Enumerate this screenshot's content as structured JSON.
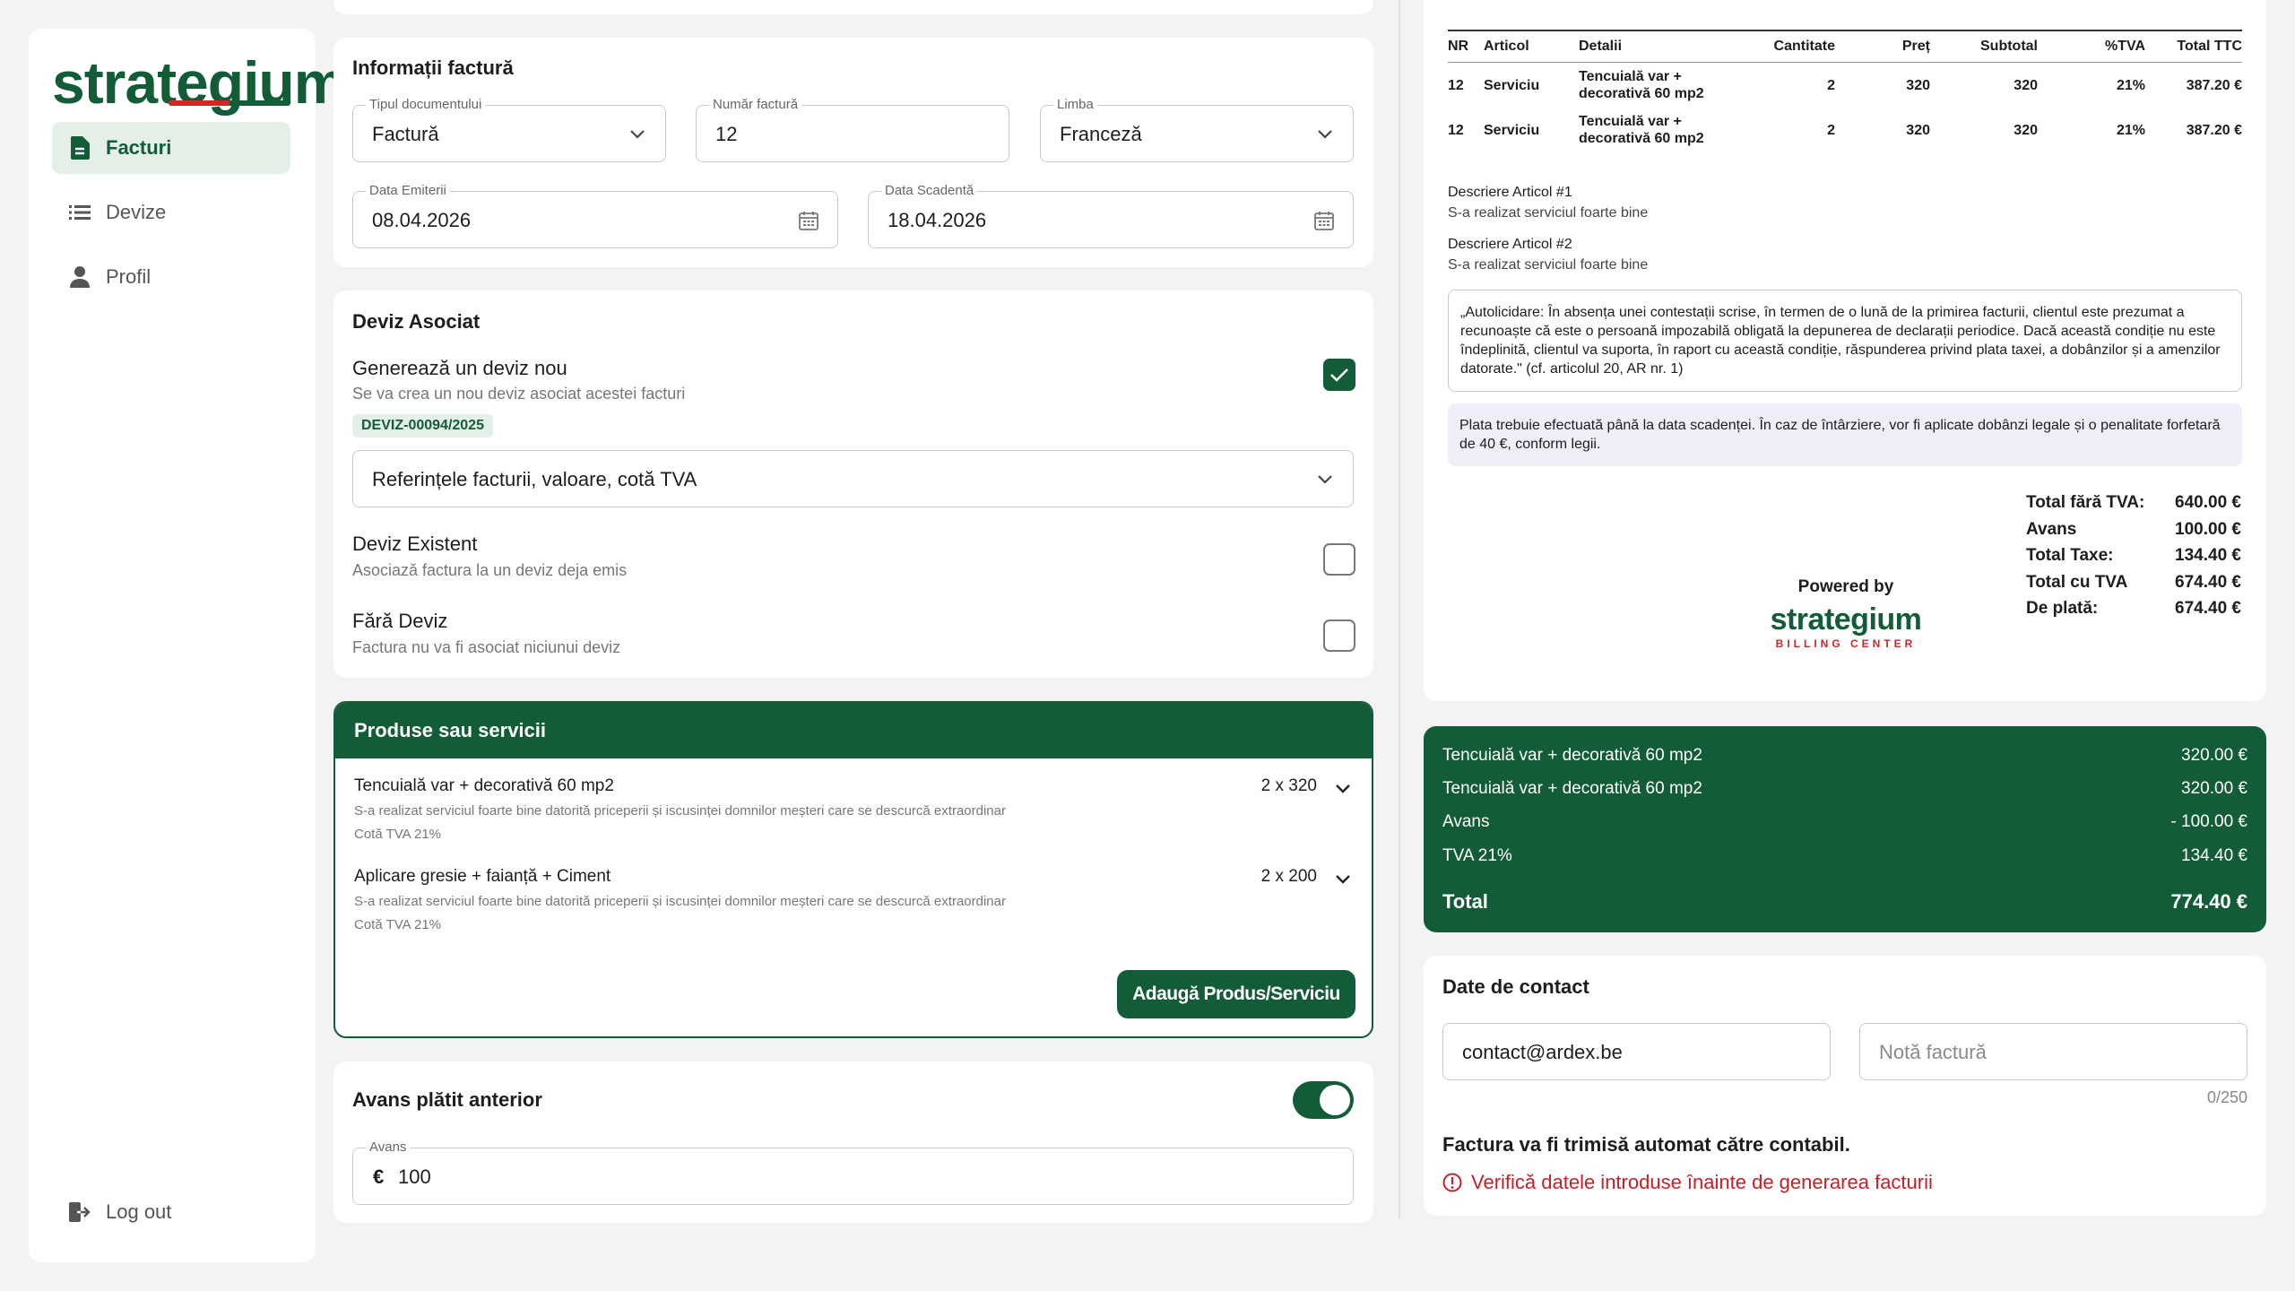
{
  "brand": {
    "logo_text": "strategium"
  },
  "sidebar": {
    "items": [
      {
        "label": "Facturi",
        "icon": "document-icon",
        "active": true
      },
      {
        "label": "Devize",
        "icon": "list-icon",
        "active": false
      },
      {
        "label": "Profil",
        "icon": "person-icon",
        "active": false
      }
    ],
    "logout_label": "Log out"
  },
  "invoice_info": {
    "title": "Informații factură",
    "doc_type": {
      "label": "Tipul documentului",
      "value": "Factură"
    },
    "number": {
      "label": "Număr factură",
      "value": "12"
    },
    "language": {
      "label": "Limba",
      "value": "Franceză"
    },
    "issue_date": {
      "label": "Data Emiterii",
      "value": "08.04.2026"
    },
    "due_date": {
      "label": "Data Scadentă",
      "value": "18.04.2026"
    }
  },
  "deviz": {
    "title": "Deviz Asociat",
    "new": {
      "title": "Generează un deviz nou",
      "subtitle": "Se va crea un nou deviz asociat acestei facturi",
      "checked": true
    },
    "badge": "DEVIZ-00094/2025",
    "select_value": "Referințele facturii, valoare, cotă TVA",
    "existing": {
      "title": "Deviz Existent",
      "subtitle": "Asociază factura la un deviz deja emis",
      "checked": false
    },
    "none": {
      "title": "Fără Deviz",
      "subtitle": "Factura nu va fi asociat niciunui deviz",
      "checked": false
    }
  },
  "products": {
    "title": "Produse sau servicii",
    "items": [
      {
        "name": "Tencuială var + decorativă 60 mp2",
        "description": "S-a realizat serviciul foarte bine datorită priceperii și iscusinței domnilor meșteri care se descurcă extraordinar",
        "tva": "Cotă TVA 21%",
        "qty": "2 x 320"
      },
      {
        "name": "Aplicare gresie + faianță + Ciment",
        "description": "S-a realizat serviciul foarte bine datorită priceperii și iscusinței domnilor meșteri care se descurcă extraordinar",
        "tva": "Cotă TVA 21%",
        "qty": "2 x 200"
      }
    ],
    "add_label": "Adaugă Produs/Serviciu"
  },
  "advance": {
    "title": "Avans plătit anterior",
    "enabled": true,
    "field_label": "Avans",
    "currency": "€",
    "value": "100"
  },
  "preview": {
    "columns": [
      "NR",
      "Articol",
      "Detalii",
      "Cantitate",
      "Preț",
      "Subtotal",
      "%TVA",
      "Total TTC"
    ],
    "rows": [
      {
        "nr": "12",
        "articol": "Serviciu",
        "detalii": "Tencuială var + decorativă 60 mp2",
        "cantitate": "2",
        "pret": "320",
        "subtotal": "320",
        "tva": "21%",
        "total": "387.20 €"
      },
      {
        "nr": "12",
        "articol": "Serviciu",
        "detalii": "Tencuială var + decorativă 60 mp2",
        "cantitate": "2",
        "pret": "320",
        "subtotal": "320",
        "tva": "21%",
        "total": "387.20 €"
      }
    ],
    "desc1_label": "Descriere Articol #1",
    "desc1_text": "S-a realizat serviciul foarte bine",
    "desc2_label": "Descriere Articol #2",
    "desc2_text": "S-a realizat serviciul foarte bine",
    "legal_text": "„Autolicidare: În absența unei contestații scrise, în termen de o lună de la primirea facturii, clientul este prezumat a recunoaște că este o persoană impozabilă obligată la depunerea de declarații periodice. Dacă această condiție nu este îndeplinită, clientul va suporta, în raport cu această condiție, răspunderea privind plata taxei, a dobânzilor și a amenzilor datorate.\" (cf. articolul 20, AR nr. 1)",
    "notice_text": "Plata trebuie efectuată până la data scadenței. În caz de întârziere, vor fi aplicate dobânzi legale și o penalitate forfetară de 40 €, conform legii.",
    "totals": [
      {
        "label": "Total fără TVA:",
        "value": "640.00 €"
      },
      {
        "label": "Avans",
        "value": "100.00 €"
      },
      {
        "label": "Total Taxe:",
        "value": "134.40 €"
      },
      {
        "label": "Total cu TVA",
        "value": "674.40 €"
      },
      {
        "label": "De plată:",
        "value": "674.40 €"
      }
    ],
    "powered_by": "Powered by",
    "powered_logo": "strategium",
    "powered_tagline": "BILLING CENTER"
  },
  "summary": {
    "rows": [
      {
        "label": "Tencuială var + decorativă 60 mp2",
        "value": "320.00 €"
      },
      {
        "label": "Tencuială var + decorativă 60 mp2",
        "value": "320.00 €"
      },
      {
        "label": "Avans",
        "value": "- 100.00 €"
      },
      {
        "label": "TVA 21%",
        "value": "134.40 €"
      }
    ],
    "total_label": "Total",
    "total_value": "774.40 €"
  },
  "contact": {
    "title": "Date de contact",
    "email_value": "contact@ardex.be",
    "note_placeholder": "Notă factură",
    "char_count": "0/250",
    "info_text": "Factura va fi trimisă automat către contabil.",
    "error_text": "Verifică datele introduse înainte de generarea facturii"
  },
  "colors": {
    "brand_green": "#135c38",
    "brand_red": "#c92a2a",
    "error_red": "#c71f2a",
    "notice_bg": "#efedf8"
  }
}
